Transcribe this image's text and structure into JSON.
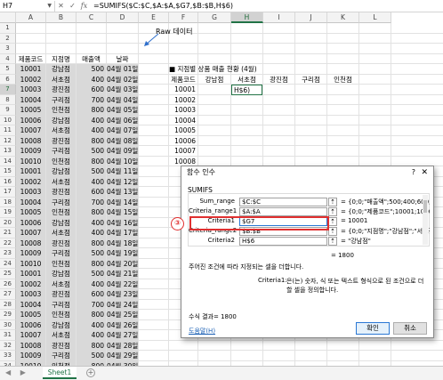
{
  "formula_bar": {
    "name_box": "H7",
    "cancel_icon": "✕",
    "enter_icon": "✓",
    "fx": "fx",
    "formula": "=SUMIFS($C:$C,$A:$A,$G7,$B:$B,H$6)"
  },
  "columns": [
    "A",
    "B",
    "C",
    "D",
    "E",
    "F",
    "G",
    "H",
    "I",
    "J",
    "K",
    "L"
  ],
  "rows": [
    "1",
    "2",
    "3",
    "4",
    "5",
    "6",
    "7",
    "8",
    "9",
    "10",
    "11",
    "12",
    "13",
    "14",
    "15",
    "16",
    "17",
    "18",
    "19",
    "20",
    "21",
    "22",
    "23",
    "24",
    "25",
    "26",
    "27",
    "28",
    "29",
    "30",
    "31",
    "32",
    "33",
    "34"
  ],
  "annotation": {
    "raw_label": "Raw 데이터",
    "badge": "③"
  },
  "raw_headers": [
    "제품코드",
    "지점명",
    "매출액",
    "날짜"
  ],
  "raw_rows": [
    [
      "10001",
      "강남점",
      "500",
      "04월 01일"
    ],
    [
      "10002",
      "서초점",
      "400",
      "04월 02일"
    ],
    [
      "10003",
      "광진점",
      "600",
      "04월 03일"
    ],
    [
      "10004",
      "구리점",
      "700",
      "04월 04일"
    ],
    [
      "10005",
      "인천점",
      "800",
      "04월 05일"
    ],
    [
      "10006",
      "강남점",
      "400",
      "04월 06일"
    ],
    [
      "10007",
      "서초점",
      "400",
      "04월 07일"
    ],
    [
      "10008",
      "광진점",
      "800",
      "04월 08일"
    ],
    [
      "10009",
      "구리점",
      "500",
      "04월 09일"
    ],
    [
      "10010",
      "인천점",
      "800",
      "04월 10일"
    ],
    [
      "10001",
      "강남점",
      "500",
      "04월 11일"
    ],
    [
      "10002",
      "서초점",
      "400",
      "04월 12일"
    ],
    [
      "10003",
      "광진점",
      "600",
      "04월 13일"
    ],
    [
      "10004",
      "구리점",
      "700",
      "04월 14일"
    ],
    [
      "10005",
      "인천점",
      "800",
      "04월 15일"
    ],
    [
      "10006",
      "강남점",
      "400",
      "04월 16일"
    ],
    [
      "10007",
      "서초점",
      "400",
      "04월 17일"
    ],
    [
      "10008",
      "광진점",
      "800",
      "04월 18일"
    ],
    [
      "10009",
      "구리점",
      "500",
      "04월 19일"
    ],
    [
      "10010",
      "인천점",
      "800",
      "04월 20일"
    ],
    [
      "10001",
      "강남점",
      "500",
      "04월 21일"
    ],
    [
      "10002",
      "서초점",
      "400",
      "04월 22일"
    ],
    [
      "10003",
      "광진점",
      "600",
      "04월 23일"
    ],
    [
      "10004",
      "구리점",
      "700",
      "04월 24일"
    ],
    [
      "10005",
      "인천점",
      "800",
      "04월 25일"
    ],
    [
      "10006",
      "강남점",
      "400",
      "04월 26일"
    ],
    [
      "10007",
      "서초점",
      "400",
      "04월 27일"
    ],
    [
      "10008",
      "광진점",
      "800",
      "04월 28일"
    ],
    [
      "10009",
      "구리점",
      "500",
      "04월 29일"
    ],
    [
      "10010",
      "인천점",
      "800",
      "04월 30일"
    ]
  ],
  "summary": {
    "title": "■ 지점별 상품 매출 현황 (4월)",
    "headers": [
      "제품코드",
      "강남점",
      "서초점",
      "광진점",
      "구리점",
      "인천점"
    ],
    "codes": [
      "10001",
      "10002",
      "10003",
      "10004",
      "10005",
      "10006",
      "10007",
      "10008"
    ],
    "active_cell_text": "H$6)"
  },
  "dialog": {
    "title": "함수 인수",
    "help_icon": "?",
    "close_icon": "✕",
    "function_name": "SUMIFS",
    "ref_icon": "⇡",
    "args": [
      {
        "label": "Sum_range",
        "value": "$C:$C",
        "eq": "= {0;0;\"매출액\";500;400;600;700;80"
      },
      {
        "label": "Criteria_range1",
        "value": "$A:$A",
        "eq": "= {0;0;\"제품코드\";10001;10002;100"
      },
      {
        "label": "Criteria1",
        "value": "$G7",
        "eq": "= 10001"
      },
      {
        "label": "Criteria_range2",
        "value": "$B:$B",
        "eq": "= {0;0;\"지점명\";\"강남점\";\"서초점\";"
      },
      {
        "label": "Criteria2",
        "value": "H$6",
        "eq": "= \"강남점\""
      }
    ],
    "total": "= 1800",
    "description": "주어진 조건에 따라 지정되는 셀을 더합니다.",
    "arg_desc_label": "Criteria1:",
    "arg_desc": "은(는) 숫자, 식 또는 텍스트 형식으로 된 조건으로 더할 셀을 정의합니다.",
    "result": "수식 결과= 1800",
    "help_link": "도움말(H)",
    "ok": "확인",
    "cancel": "취소"
  },
  "sheet_tabs": {
    "nav": "◀ ▶",
    "active": "Sheet1",
    "add": "+"
  }
}
